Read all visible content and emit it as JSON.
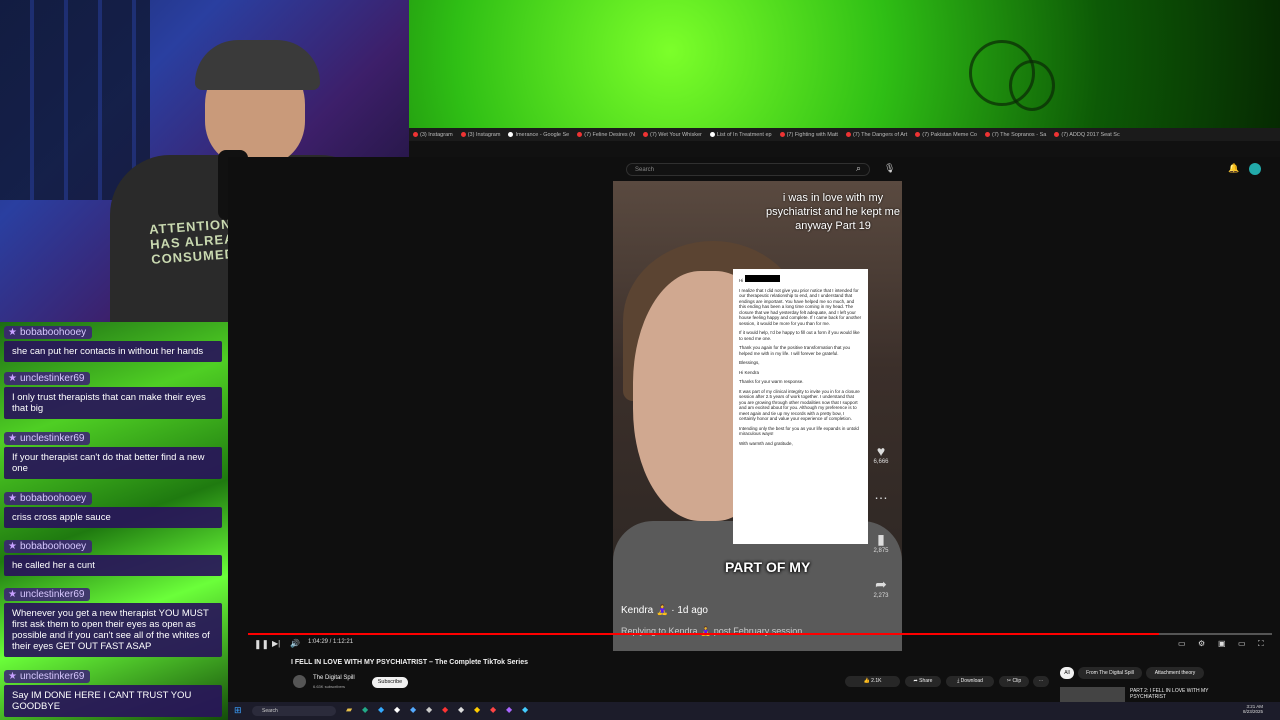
{
  "chat": {
    "messages": [
      {
        "user": "bobaboohooey",
        "text": "she can put her contacts in without her hands"
      },
      {
        "user": "unclestinker69",
        "text": "I only trust therapists that can make their eyes that big"
      },
      {
        "user": "unclestinker69",
        "text": "If your therapist can't do that better find a new one"
      },
      {
        "user": "bobaboohooey",
        "text": "criss cross apple sauce"
      },
      {
        "user": "bobaboohooey",
        "text": "he called her a cunt"
      },
      {
        "user": "unclestinker69",
        "text": "Whenever you get a new therapist YOU MUST first ask them to open their eyes as open as possible and if you can't see all of the whites of their eyes GET OUT FAST ASAP"
      },
      {
        "user": "unclestinker69",
        "text": "Say IM DONE HERE I CANT TRUST YOU GOODBYE"
      }
    ]
  },
  "browser": {
    "tabs": [
      "(3) Instagram",
      "(3) Instagram",
      "Imerance - Google Se",
      "(7) Feline Desires (N",
      "(7) Wet Your Whisker",
      "List of In Treatment ep",
      "(7) Fighting with Matt",
      "(7) The Dangers of Art",
      "(7) Pakistan Meme Co",
      "(7) The Sopranos - Sa",
      "(7) ADDQ 2017 Seat Sc"
    ],
    "search_placeholder": "Search"
  },
  "video": {
    "overlay_title": "i was in love with my psychiatrist and he kept me anyway Part 19",
    "email_greeting": "Hi",
    "email_p1": "I realize that I did not give you prior notice that I intended for our therapeutic relationship to end, and I understand that endings are important. You have helped me so much, and this ending has been a long time coming in my head. The closure that we had yesterday felt adequate, and I left your house feeling happy and complete. If I came back for another session, it would be more for you than for me.",
    "email_p2": "If it would help, I'd be happy to fill out a form if you would like to send me one.",
    "email_p3": "Thank you again for the positive transformation that you helped me with in my life. I will forever be grateful.",
    "email_sign": "Blessings,",
    "email_reply_greeting": "Hi Kendra",
    "email_reply_p1": "Thanks for your warm response.",
    "email_reply_p2": "It was part of my clinical integrity to invite you in for a closure session after 2.5 years of work together. I understand that you are growing through other modalities now that I support and am excited about for you. Although my preference is to meet again and tie up my records with a pretty bow, I certainly honor and value your experience of completion.",
    "email_reply_p3": "Intending only the best for you as your life expands in untold miraculous ways!",
    "email_reply_sign": "With warmth and gratitude,",
    "caption": "PART OF MY",
    "creator": "Kendra 🧘‍♀️ · 1d ago",
    "reply_text": "Replying to Kendra 🧘‍♀️ post February session",
    "likes": "6,666",
    "saves": "2,875",
    "shares": "2,273",
    "time": "1:04:29 / 1:12:21",
    "progress": 0.89
  },
  "youtube": {
    "title": "I FELL IN LOVE WITH MY PSYCHIATRIST – The Complete TikTok Series",
    "channel": "The Digital Spill",
    "subscribers": "6.63K subscribers",
    "subscribe_label": "Subscribe",
    "like_count": "2.1K",
    "share_label": "Share",
    "download_label": "Download",
    "clip_label": "Clip",
    "chips": [
      "All",
      "From The Digital Spill",
      "Attachment theory"
    ],
    "rec_title": "PART 2: I FELL IN LOVE WITH MY PSYCHIATRIST"
  },
  "taskbar": {
    "search_placeholder": "Search",
    "time": "3:21 AM",
    "date": "8/23/2025"
  },
  "webcam": {
    "shirt_text": "ATTENTION THIS BRAIN HAS ALREADY BEEN CONSUMED"
  }
}
